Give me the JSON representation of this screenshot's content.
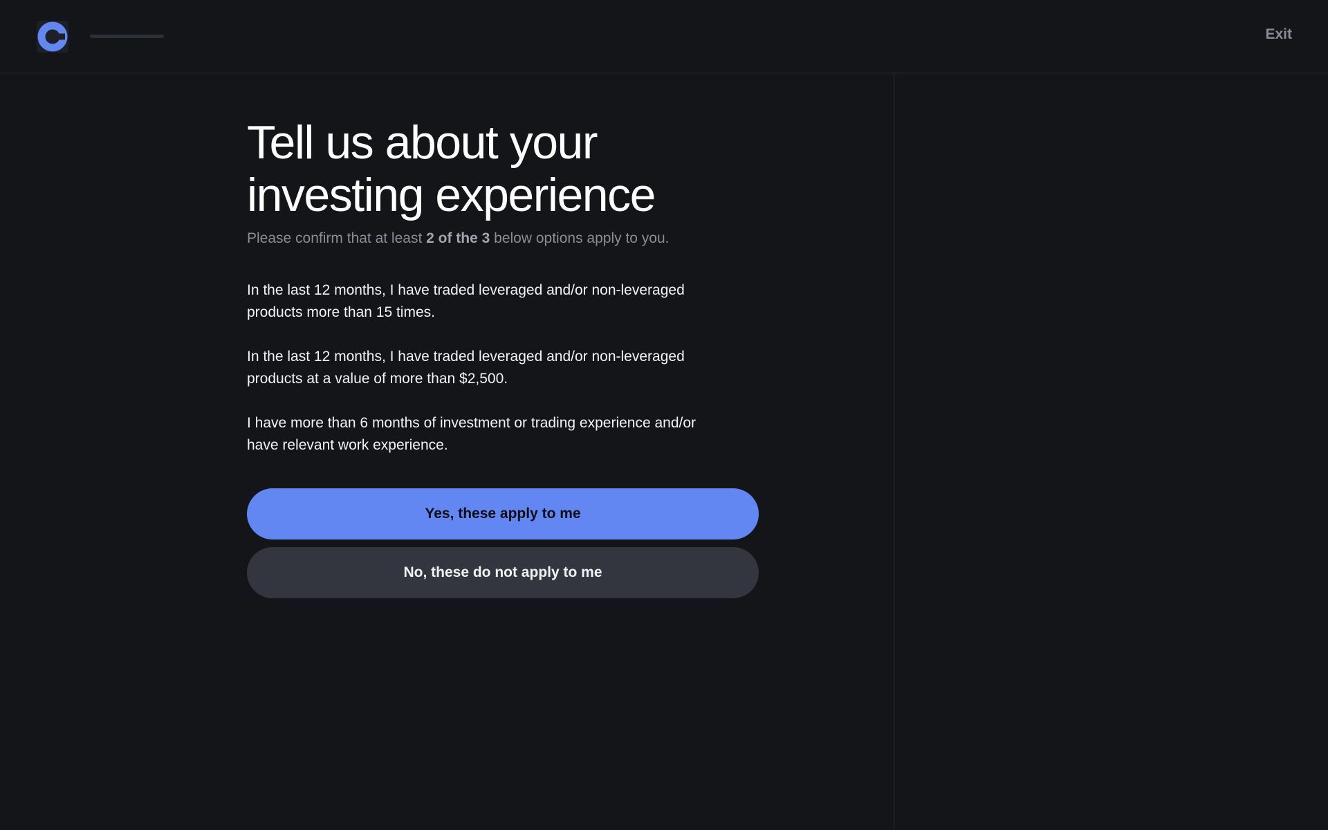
{
  "header": {
    "logo_icon": "coinbase-logo-icon",
    "progress": 0.0,
    "exit_label": "Exit"
  },
  "main": {
    "title_line1": "Tell us about your",
    "title_line2": "investing experience",
    "subtitle_pre": "Please confirm that at least ",
    "subtitle_bold": "2 of the 3",
    "subtitle_post": " below options apply to you.",
    "options": [
      {
        "line1": "In the last 12 months, I have traded leveraged and/or non-leveraged",
        "line2": "products more than 15 times."
      },
      {
        "line1": "In the last 12 months, I have traded leveraged and/or non-leveraged",
        "line2": "products at a value of more than $2,500."
      },
      {
        "line1": "I have more than 6 months of investment or trading experience and/or",
        "line2": "have relevant work experience."
      }
    ],
    "yes_label": "Yes, these apply to me",
    "no_label": "No, these do not apply to me"
  },
  "colors": {
    "background": "#141519",
    "accent": "#6287f2",
    "secondary_button": "#34363f",
    "muted_text": "#8a8d96"
  }
}
